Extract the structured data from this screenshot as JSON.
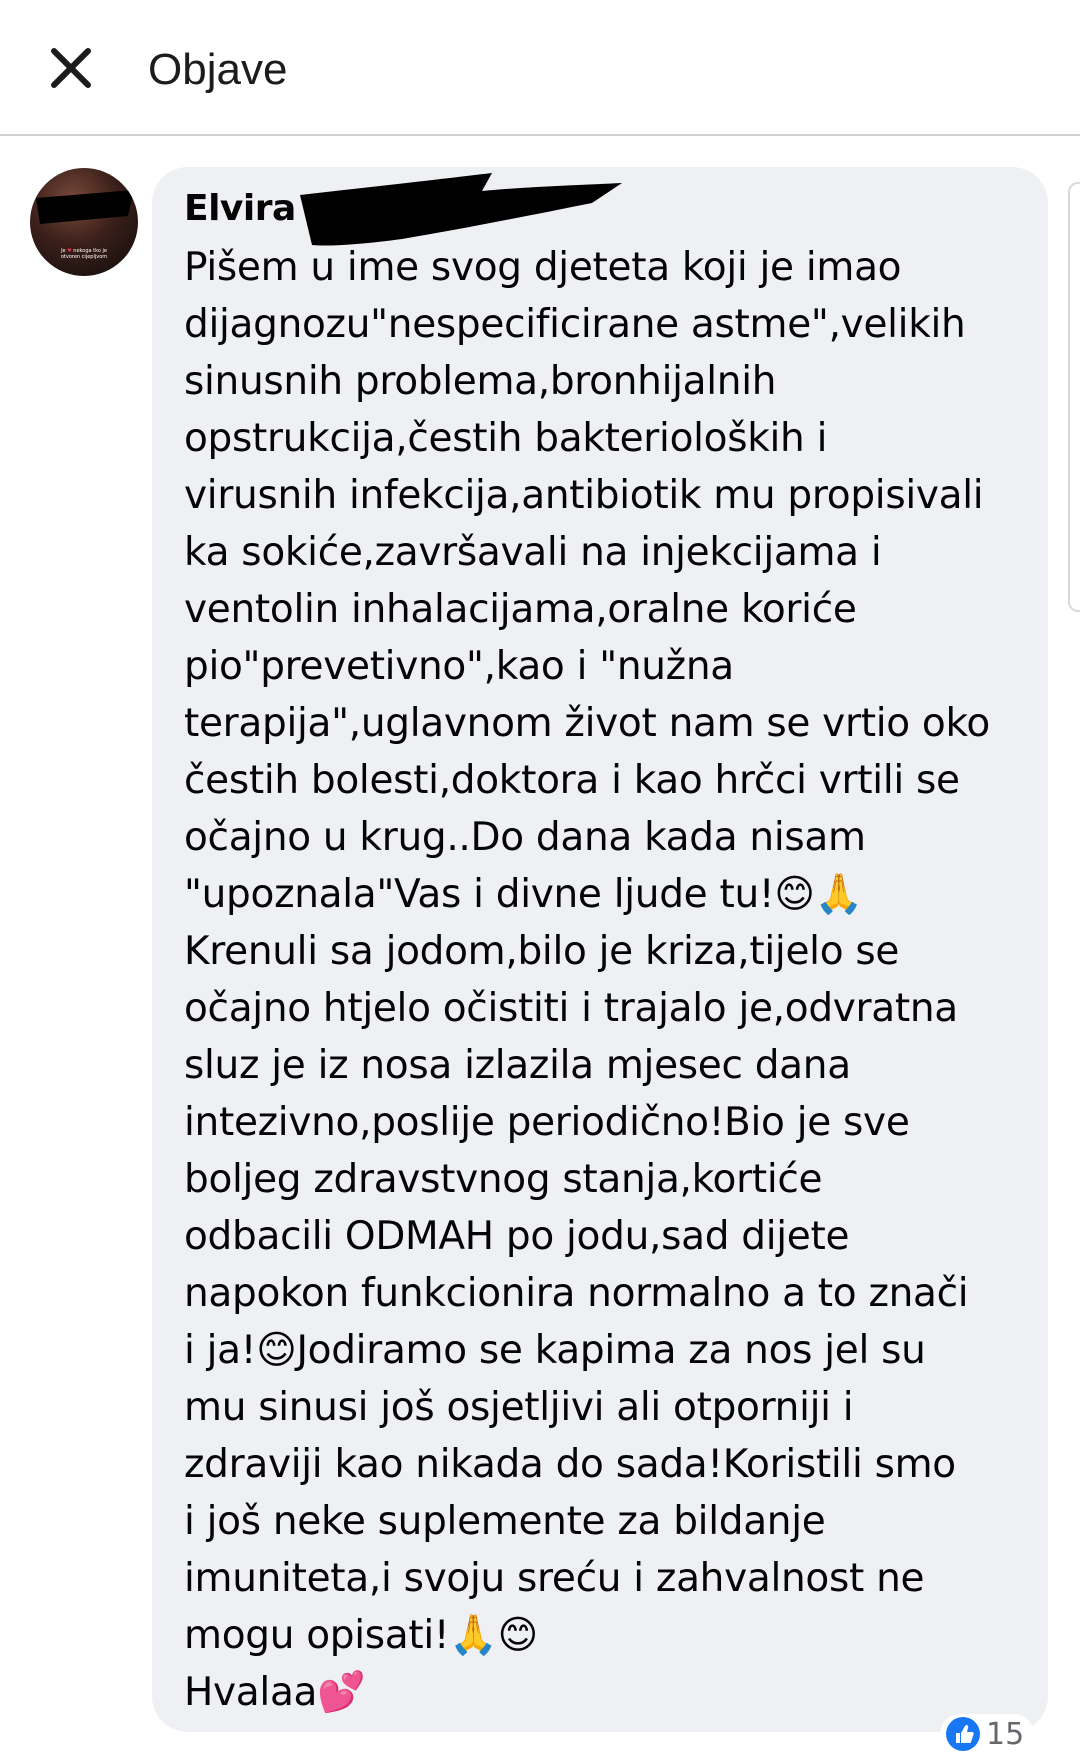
{
  "header": {
    "title": "Objave"
  },
  "avatar": {
    "caption_prefix": "Je",
    "caption_rest": "nekoga tko je",
    "caption_line2": "otvoren cijepljvom"
  },
  "comment": {
    "author": "Elvira B",
    "lines": [
      "Pišem u ime svog djeteta koji je imao",
      "dijagnozu\"nespecificirane astme\",velikih",
      "sinusnih problema,bronhijalnih",
      "opstrukcija,čestih bakterioloških i",
      "virusnih infekcija,antibiotik mu propisivali",
      "ka sokiće,završavali na injekcijama i",
      "ventolin inhalacijama,oralne koriće",
      "pio\"prevetivno\",kao i \"nužna",
      "terapija\",uglavnom život nam se vrtio oko",
      "čestih bolesti,doktora i kao hrčci vrtili se",
      "očajno u krug..Do dana kada nisam",
      "\"upoznala\"Vas i divne ljude tu!😊🙏",
      "Krenuli sa jodom,bilo je kriza,tijelo se",
      "očajno htjelo očistiti i trajalo je,odvratna",
      "sluz je iz nosa izlazila mjesec dana",
      "intezivno,poslije periodično!Bio je sve",
      "boljeg zdravstvnog stanja,kortiće",
      "odbacili ODMAH po jodu,sad dijete",
      "napokon funkcionira normalno a to znači",
      "i ja!😊Jodiramo se kapima za nos jel su",
      "mu sinusi još osjetljivi ali otporniji i",
      "zdraviji kao nikada do sada!Koristili smo",
      "i još neke suplemente za bildanje",
      "imuniteta,i svoju sreću i zahvalnost ne",
      "mogu opisati!🙏😊",
      "Hvalaa💕"
    ]
  },
  "reactions": {
    "count": "15",
    "icon": "like-icon"
  },
  "colors": {
    "bubble": "#eef0f3",
    "like": "#1877f2"
  }
}
